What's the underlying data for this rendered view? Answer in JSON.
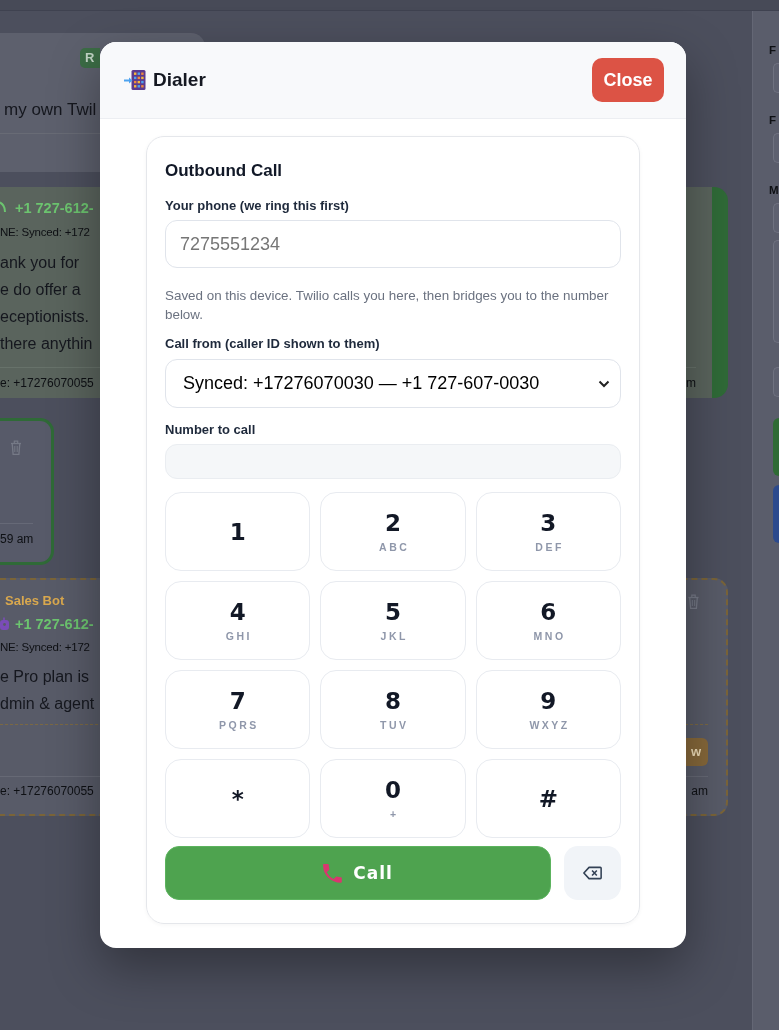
{
  "background": {
    "header_card": {
      "badge": "R",
      "text": "my own Twil"
    },
    "messages": [
      {
        "kind": "sent",
        "phone": "+1 727-612-",
        "line": "NE: Synced: +172",
        "body": "ank you for\ne do offer a\neceptionists.\nthere anythin",
        "footer": "e: +17276070055",
        "time": "m"
      },
      {
        "kind": "note",
        "time": "59 am"
      },
      {
        "kind": "bot",
        "sender": "Sales Bot",
        "phone": "+1 727-612-",
        "line": "NE: Synced: +172",
        "body": "e Pro plan is\ndmin & agent",
        "action": "w",
        "footer": "e: +17276070055",
        "time": "am"
      }
    ],
    "sidebar": {
      "fields": [
        {
          "kind": "input",
          "label": "F"
        },
        {
          "kind": "input",
          "label": "F"
        },
        {
          "kind": "input",
          "label": "M"
        },
        {
          "kind": "textarea"
        },
        {
          "kind": "input"
        }
      ],
      "buttons": [
        {
          "color": "#2f6b35"
        },
        {
          "color": "#2c4a8d"
        }
      ]
    }
  },
  "dialog": {
    "title": "Dialer",
    "close_button": "Close",
    "outbound_call": {
      "title": "Outbound Call",
      "your_phone": {
        "label": "Your phone (we ring this first)",
        "placeholder": "7275551234",
        "hint": "Saved on this device. Twilio calls you here, then bridges you to the number below."
      },
      "call_from": {
        "label": "Call from (caller ID shown to them)",
        "value": "Synced: +17276070030 — +1 727-607-0030"
      },
      "number_to_call": {
        "label": "Number to call"
      },
      "keypad": [
        {
          "digit": "1"
        },
        {
          "digit": "2",
          "letters": "ABC"
        },
        {
          "digit": "3",
          "letters": "DEF"
        },
        {
          "digit": "4",
          "letters": "GHI"
        },
        {
          "digit": "5",
          "letters": "JKL"
        },
        {
          "digit": "6",
          "letters": "MNO"
        },
        {
          "digit": "7",
          "letters": "PQRS"
        },
        {
          "digit": "8",
          "letters": "TUV"
        },
        {
          "digit": "9",
          "letters": "WXYZ"
        },
        {
          "digit": "*"
        },
        {
          "digit": "0",
          "letters": "+"
        },
        {
          "digit": "#"
        }
      ],
      "call_button": "Call"
    }
  }
}
